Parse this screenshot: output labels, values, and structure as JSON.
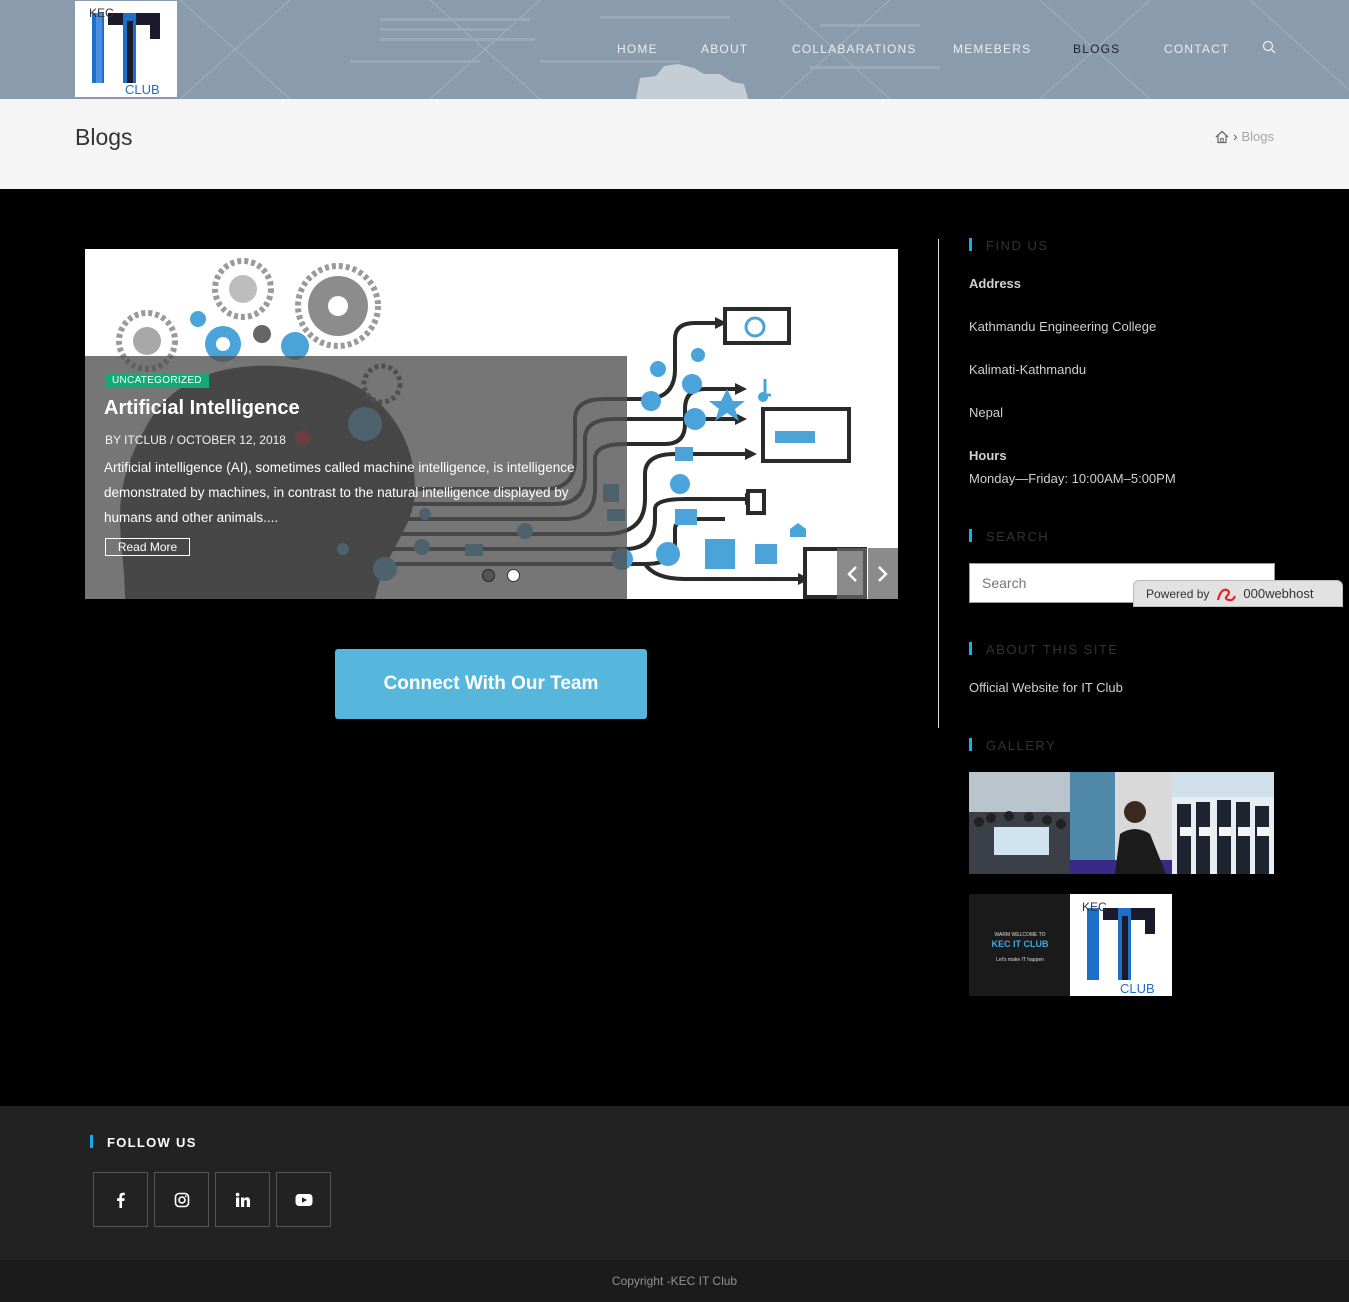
{
  "header": {
    "logo_top": "KEC",
    "logo_main": "IT",
    "logo_bottom": "CLUB",
    "nav": [
      {
        "label": "HOME"
      },
      {
        "label": "ABOUT"
      },
      {
        "label": "COLLABARATIONS"
      },
      {
        "label": "MEMEBERS"
      },
      {
        "label": "BLOGS",
        "active": true
      },
      {
        "label": "CONTACT"
      }
    ]
  },
  "titlebar": {
    "title": "Blogs",
    "breadcrumb_current": "Blogs"
  },
  "slider": {
    "category": "UNCATEGORIZED",
    "title": "Artificial Intelligence",
    "meta": "BY ITCLUB  /  OCTOBER 12, 2018",
    "excerpt": "Artificial intelligence (AI), sometimes called machine intelligence, is intelligence demonstrated by machines, in contrast to the natural intelligence displayed by humans and other animals....",
    "read_more": "Read More",
    "active_slide": 2,
    "slide_count": 2
  },
  "cta": {
    "label": "Connect With Our Team"
  },
  "sidebar": {
    "find_us": {
      "title": "FIND US",
      "address_label": "Address",
      "address_lines": [
        "Kathmandu Engineering College",
        "Kalimati-Kathmandu",
        "Nepal"
      ],
      "hours_label": "Hours",
      "hours": "Monday—Friday: 10:00AM–5:00PM"
    },
    "search": {
      "title": "SEARCH",
      "placeholder": "Search"
    },
    "powered_by": {
      "label": "Powered by",
      "brand": "000webhost"
    },
    "about": {
      "title": "ABOUT THIS SITE",
      "text": "Official Website for IT Club"
    },
    "gallery": {
      "title": "GALLERY",
      "welcome_line1": "WARM WELCOME TO",
      "welcome_line2": "KEC IT CLUB",
      "welcome_line3": "Let's make IT happen"
    }
  },
  "footer": {
    "follow_title": "FOLLOW US",
    "social": [
      "facebook-icon",
      "instagram-icon",
      "linkedin-icon",
      "youtube-icon"
    ],
    "copyright": "Copyright -KEC IT Club"
  },
  "colors": {
    "header_bg": "#8a9bab",
    "accent": "#13aff0",
    "cta": "#57b6dc",
    "badge": "#13aa75"
  }
}
